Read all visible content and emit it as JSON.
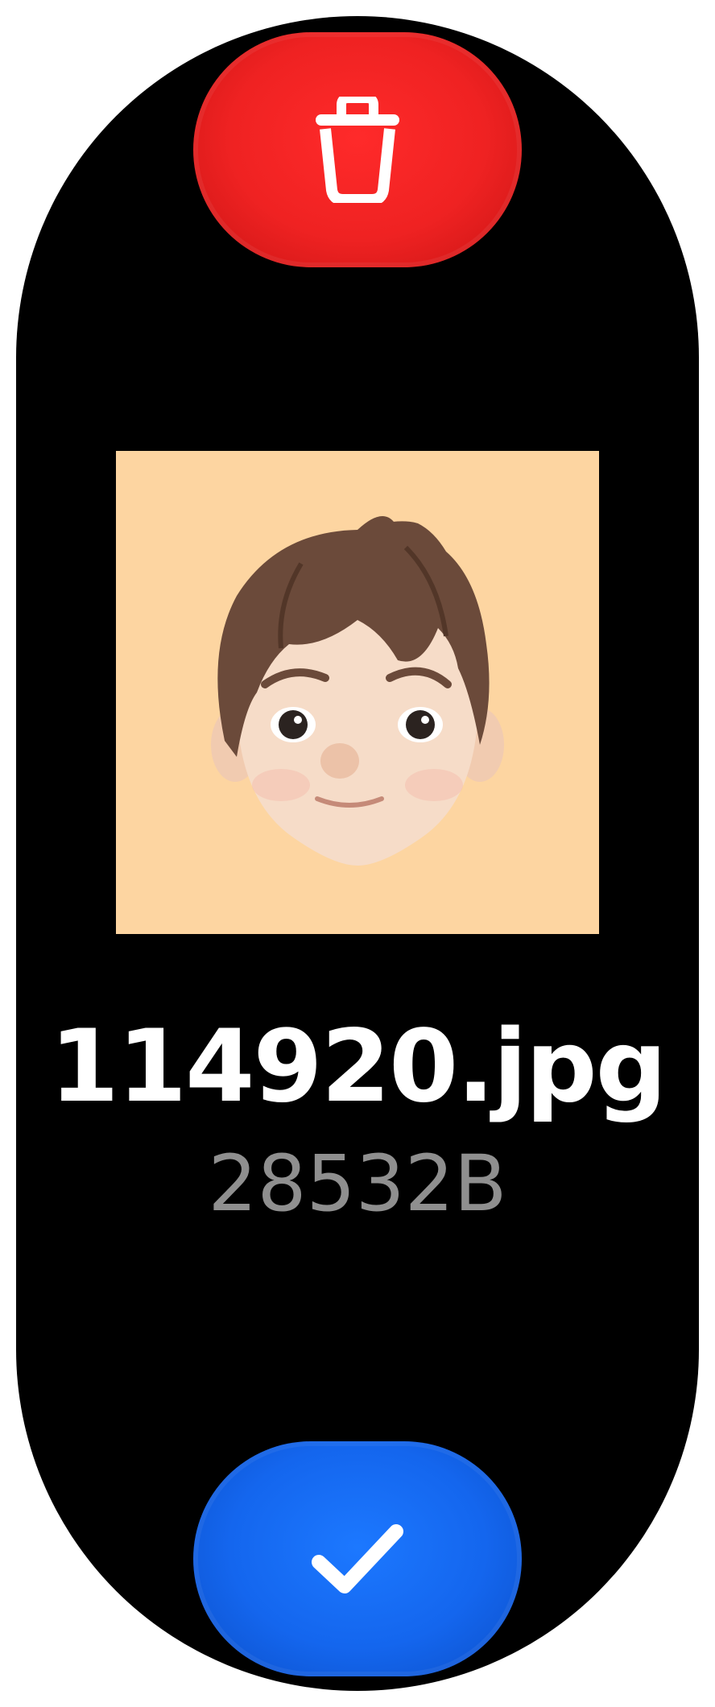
{
  "file": {
    "name": "114920.jpg",
    "size": "28532B"
  },
  "actions": {
    "delete_icon": "trash-icon",
    "confirm_icon": "checkmark-icon"
  },
  "preview": {
    "image": "memoji-avatar",
    "background_color": "#fdd5a1"
  },
  "colors": {
    "delete_button": "#ef2222",
    "confirm_button": "#1466ee",
    "filename_text": "#ffffff",
    "filesize_text": "#8f8f8f",
    "background": "#000000"
  }
}
